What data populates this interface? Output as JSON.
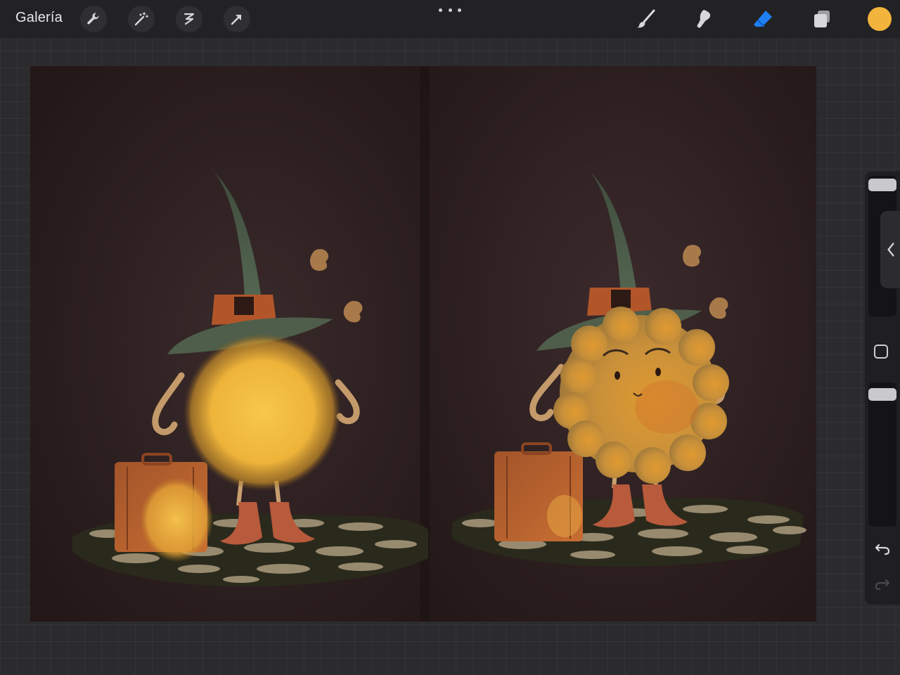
{
  "toolbar": {
    "gallery_label": "Galería",
    "tools": [
      "wrench-icon",
      "magic-wand-icon",
      "selection-icon",
      "transform-arrow-icon"
    ],
    "more_menu": "ellipsis-icon",
    "right_tools": [
      "brush-icon",
      "smudge-icon",
      "eraser-icon",
      "layers-icon"
    ],
    "active_tool": "eraser-icon",
    "active_tool_color": "#1f7ff2",
    "current_color": "#f2b43c"
  },
  "sidebar": {
    "brush_size_level": 0.02,
    "opacity_level": 0.03,
    "buttons": [
      "collapse-chevron-icon",
      "modify-square-icon",
      "undo-icon",
      "redo-icon"
    ]
  },
  "canvas": {
    "background": "#2d1f1f",
    "panels": [
      "left-illustration-in-progress",
      "right-illustration-finished"
    ]
  }
}
